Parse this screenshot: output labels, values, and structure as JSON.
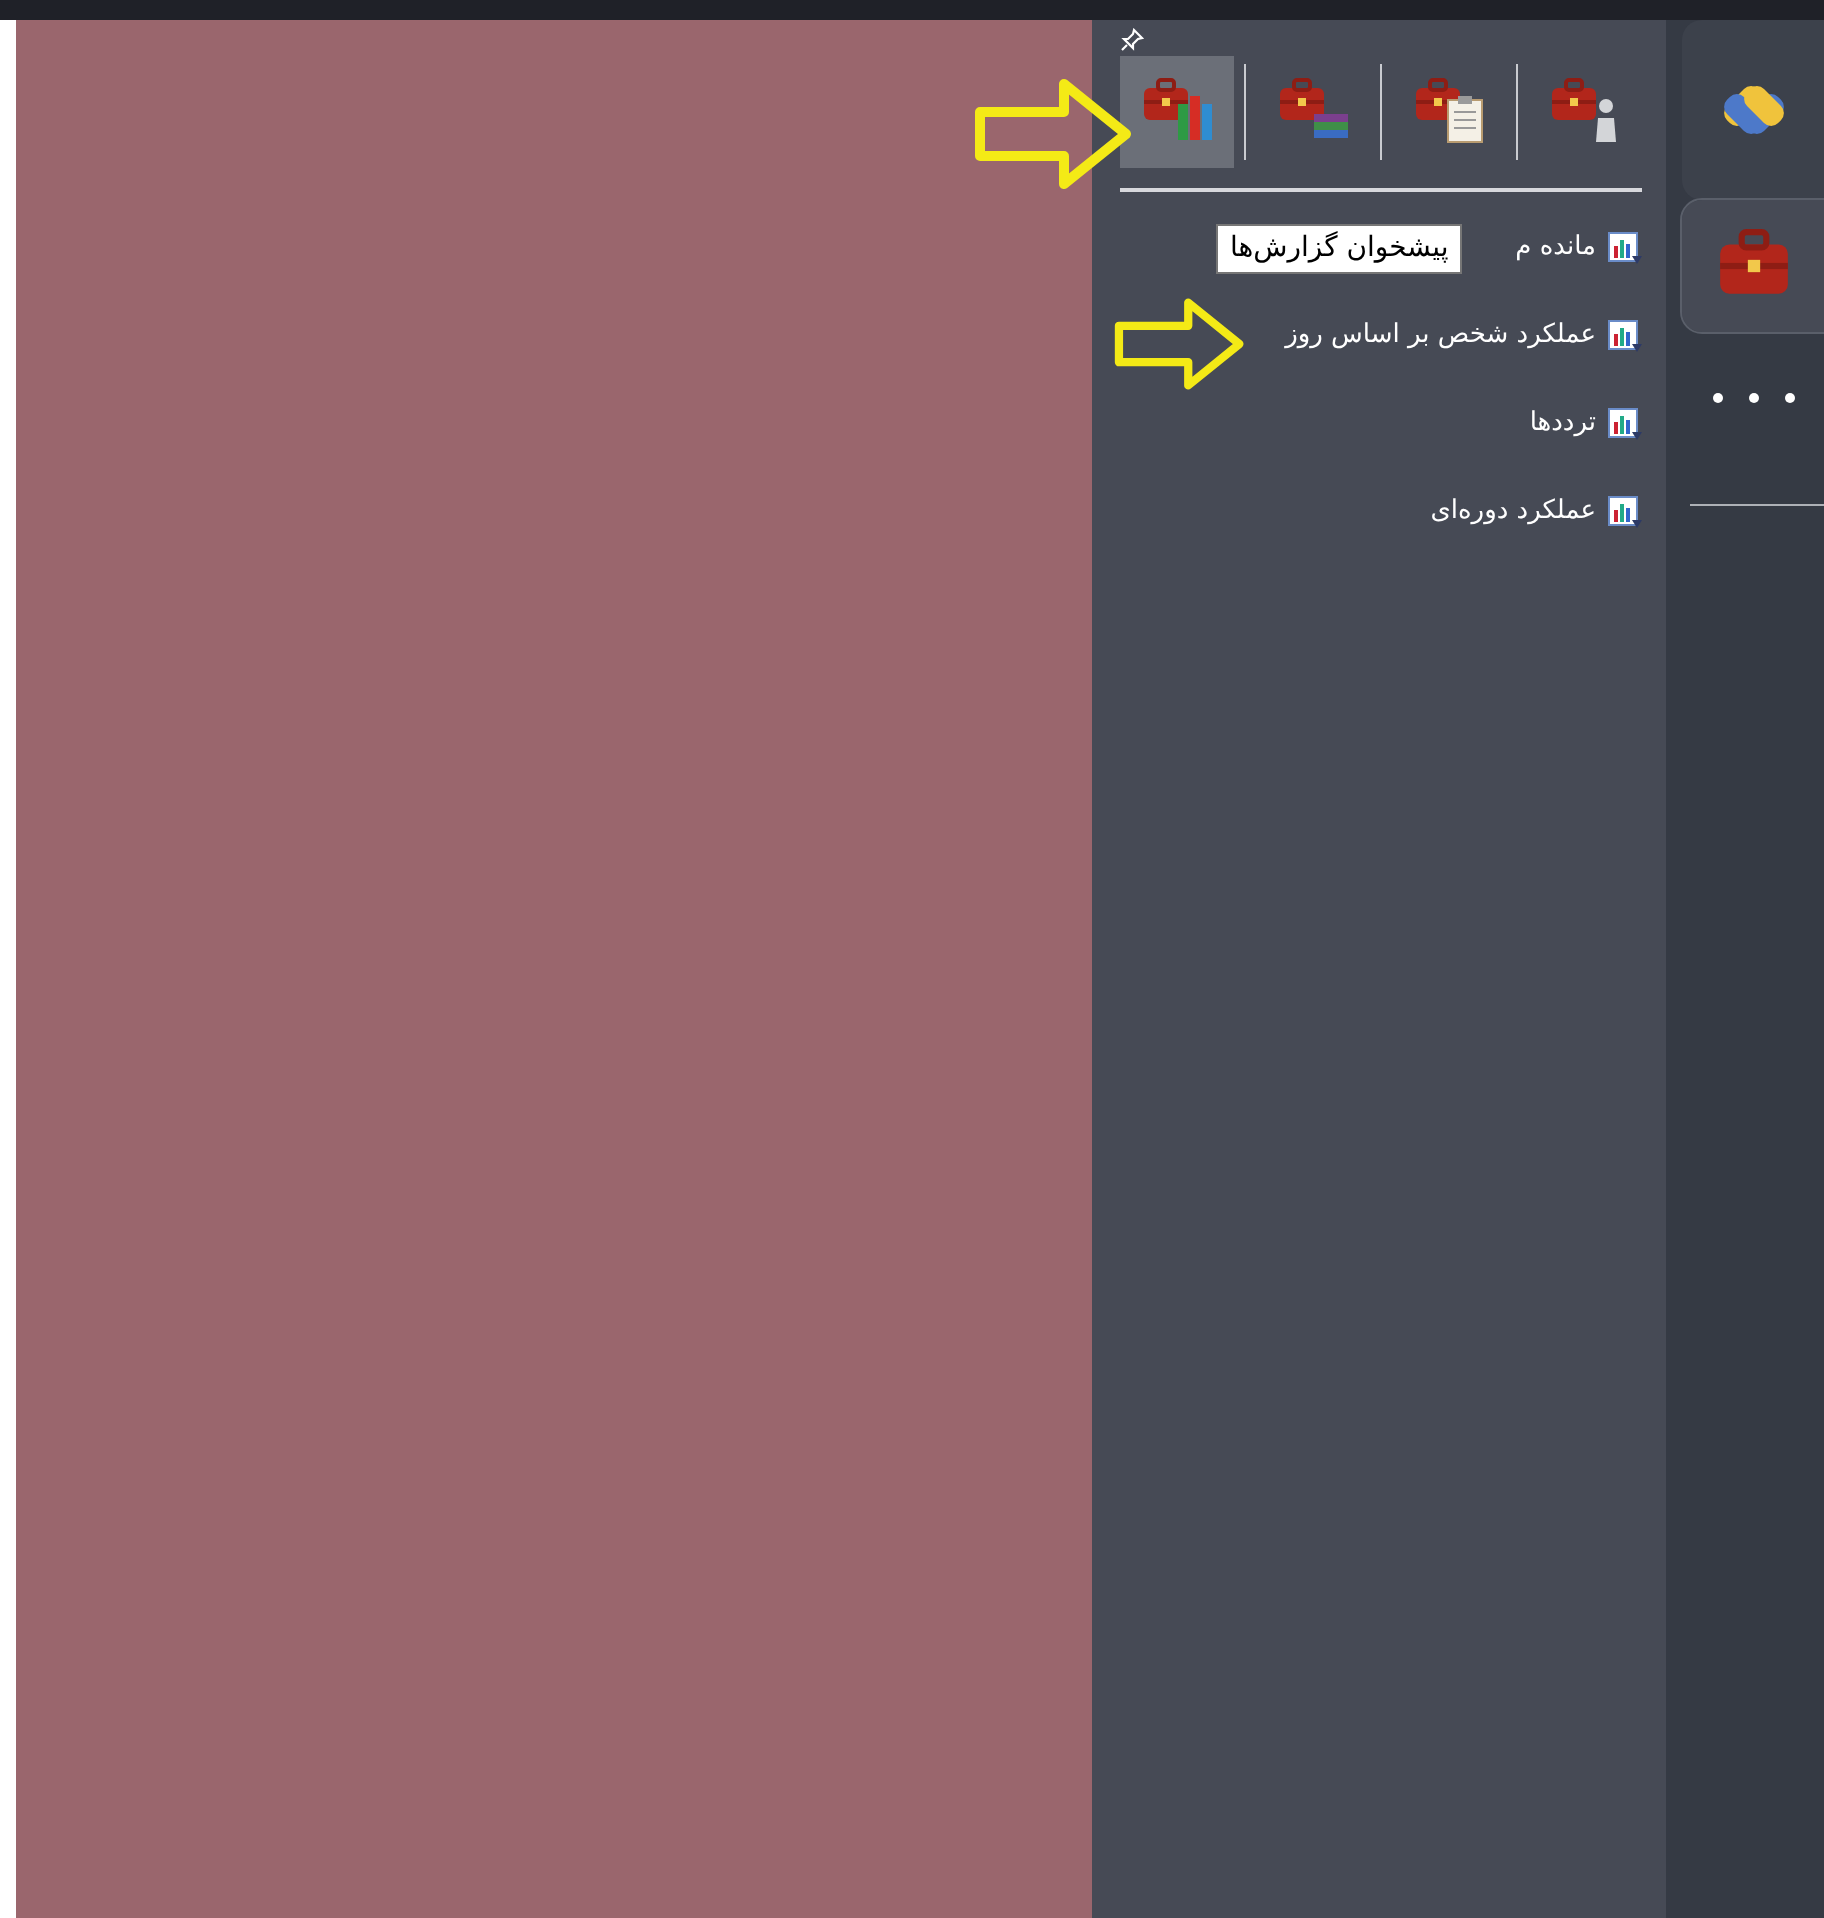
{
  "toolbar": {
    "buttons": [
      {
        "kind": "chart",
        "selected": true
      },
      {
        "kind": "layers",
        "selected": false
      },
      {
        "kind": "clipboard",
        "selected": false
      },
      {
        "kind": "person",
        "selected": false
      }
    ]
  },
  "tooltip": {
    "text": "پیشخوان گزارش‌ها"
  },
  "menu_items": [
    {
      "label": "مانده م"
    },
    {
      "label": "عملکرد شخص بر اساس روز"
    },
    {
      "label": "ترددها"
    },
    {
      "label": "عملکرد دوره‌ای"
    }
  ],
  "rail": {
    "tabs": [
      {
        "kind": "logo",
        "selected": false
      },
      {
        "kind": "briefcase",
        "selected": true
      },
      {
        "kind": "more",
        "selected": false
      }
    ]
  },
  "annotations": [
    {
      "kind": "arrow"
    },
    {
      "kind": "arrow"
    }
  ]
}
